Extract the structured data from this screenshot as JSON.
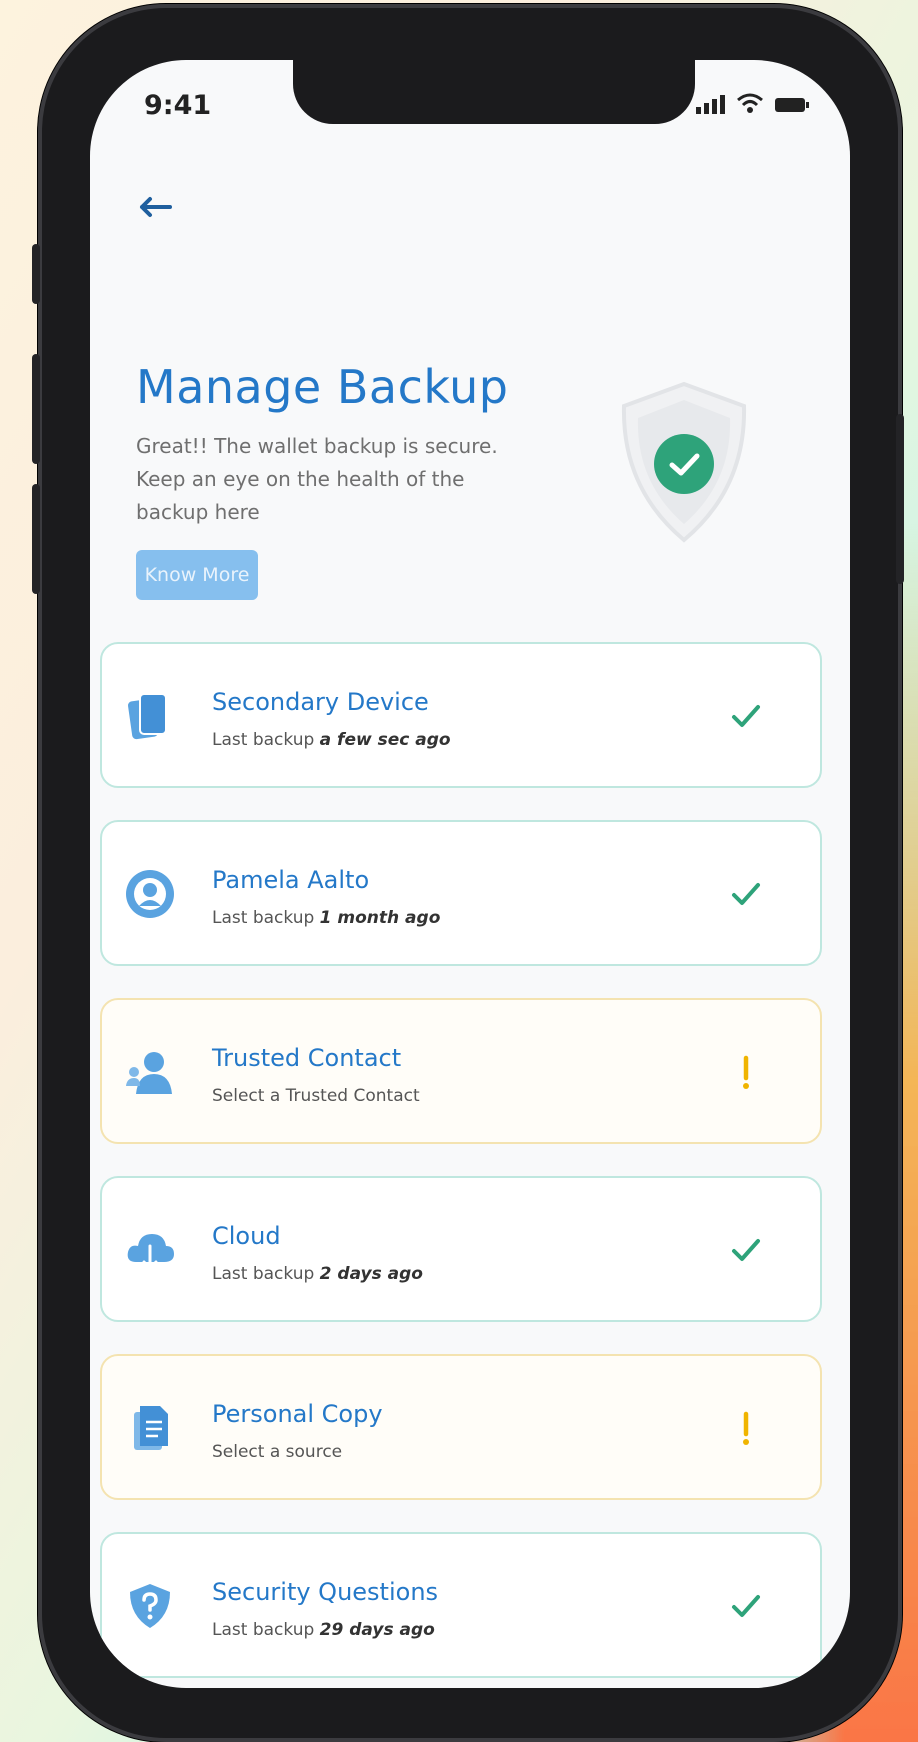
{
  "status_bar": {
    "time": "9:41"
  },
  "header": {
    "back_icon": "arrow-left-icon",
    "title": "Manage Backup",
    "subtitle": "Great!! The wallet backup is secure. Keep an eye on the health of the backup here",
    "know_more_label": "Know More",
    "badge_icon": "shield-check-icon"
  },
  "colors": {
    "accent": "#2478c8",
    "ok": "#2ea37a",
    "warn": "#f0b400",
    "card_border_ok": "#bfe7df",
    "card_border_warn": "#f4e3b0"
  },
  "backups": [
    {
      "name": "Secondary Device",
      "prefix": "Last backup",
      "detail": "a few sec ago",
      "icon": "device-icon",
      "status": "ok"
    },
    {
      "name": "Pamela Aalto",
      "prefix": "Last backup",
      "detail": "1 month ago",
      "icon": "contact-avatar-icon",
      "status": "ok"
    },
    {
      "name": "Trusted Contact",
      "prefix": "Select a Trusted Contact",
      "detail": "",
      "icon": "trusted-contact-icon",
      "status": "warn"
    },
    {
      "name": "Cloud",
      "prefix": "Last backup",
      "detail": "2 days ago",
      "icon": "cloud-icon",
      "status": "ok"
    },
    {
      "name": "Personal Copy",
      "prefix": "Select a source",
      "detail": "",
      "icon": "document-icon",
      "status": "warn"
    },
    {
      "name": "Security Questions",
      "prefix": "Last backup",
      "detail": "29 days ago",
      "icon": "shield-question-icon",
      "status": "ok"
    }
  ]
}
